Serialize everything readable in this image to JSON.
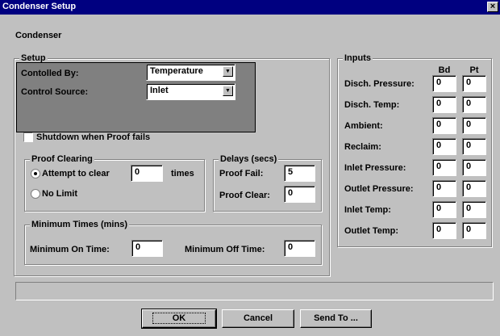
{
  "window": {
    "title": "Condenser Setup",
    "close_glyph": "×"
  },
  "heading": "Condenser",
  "setup": {
    "legend": "Setup",
    "controlled_by_label": "Contolled By:",
    "controlled_by_value": "Temperature",
    "control_source_label": "Control Source:",
    "control_source_value": "Inlet",
    "shutdown_label": "Shutdown when Proof fails",
    "shutdown_checked": false,
    "highlight_color": "#808080"
  },
  "proof_clearing": {
    "legend": "Proof Clearing",
    "attempt_label": "Attempt to clear",
    "attempt_value": "0",
    "times_label": "times",
    "no_limit_label": "No Limit",
    "selected": "attempt"
  },
  "delays": {
    "legend": "Delays (secs)",
    "proof_fail_label": "Proof Fail:",
    "proof_fail_value": "5",
    "proof_clear_label": "Proof Clear:",
    "proof_clear_value": "0"
  },
  "minimum_times": {
    "legend": "Minimum Times (mins)",
    "on_label": "Minimum On Time:",
    "on_value": "0",
    "off_label": "Minimum Off Time:",
    "off_value": "0"
  },
  "inputs": {
    "legend": "Inputs",
    "col_bd": "Bd",
    "col_pt": "Pt",
    "rows": [
      {
        "label": "Disch. Pressure:",
        "bd": "0",
        "pt": "0"
      },
      {
        "label": "Disch. Temp:",
        "bd": "0",
        "pt": "0"
      },
      {
        "label": "Ambient:",
        "bd": "0",
        "pt": "0"
      },
      {
        "label": "Reclaim:",
        "bd": "0",
        "pt": "0"
      },
      {
        "label": "Inlet Pressure:",
        "bd": "0",
        "pt": "0"
      },
      {
        "label": "Outlet Pressure:",
        "bd": "0",
        "pt": "0"
      },
      {
        "label": "Inlet Temp:",
        "bd": "0",
        "pt": "0"
      },
      {
        "label": "Outlet Temp:",
        "bd": "0",
        "pt": "0"
      }
    ]
  },
  "buttons": {
    "ok": "OK",
    "cancel": "Cancel",
    "send_to": "Send To ..."
  },
  "colors": {
    "title_bar": "#000080",
    "face": "#c0c0c0"
  }
}
